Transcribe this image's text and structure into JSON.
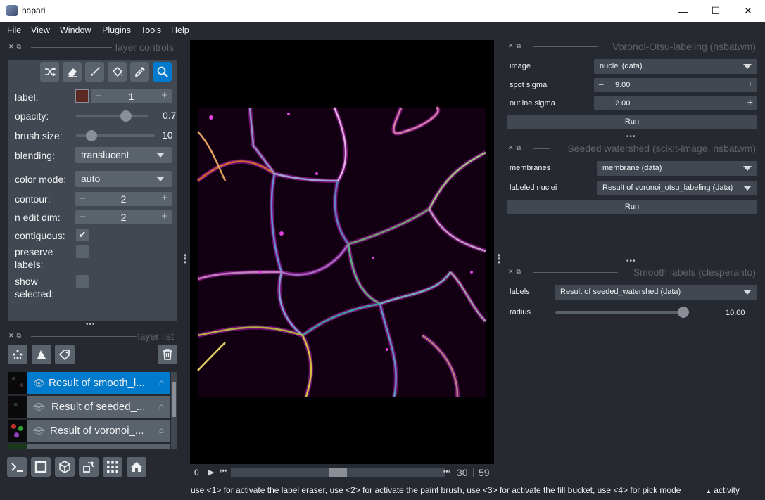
{
  "window": {
    "title": "napari",
    "minimize_glyph": "—",
    "maximize_glyph": "☐",
    "close_glyph": "✕"
  },
  "menu": [
    "File",
    "View",
    "Window",
    "Plugins",
    "Tools",
    "Help"
  ],
  "layer_controls": {
    "title": "layer controls",
    "tools": [
      "shuffle-icon",
      "eraser-icon",
      "paint-brush-icon",
      "fill-bucket-icon",
      "color-picker-icon",
      "zoom-icon"
    ],
    "label": {
      "text": "label:",
      "value": "1",
      "color": "#5a2a22"
    },
    "opacity": {
      "text": "opacity:",
      "value": "0.70",
      "fraction": 0.7
    },
    "brush_size": {
      "text": "brush size:",
      "value": "10",
      "fraction": 0.2
    },
    "blending": {
      "text": "blending:",
      "value": "translucent"
    },
    "color_mode": {
      "text": "color mode:",
      "value": "auto"
    },
    "contour": {
      "text": "contour:",
      "value": "2"
    },
    "n_edit_dim": {
      "text": "n edit dim:",
      "value": "2"
    },
    "contiguous": {
      "text": "contiguous:",
      "checked": true,
      "check_glyph": "✔"
    },
    "preserve_labels": {
      "text_line1": "preserve",
      "text_line2": "labels:",
      "checked": false
    },
    "show_selected": {
      "text_line1": "show",
      "text_line2": "selected:",
      "checked": false
    },
    "minus_glyph": "−",
    "plus_glyph": "+"
  },
  "layer_list": {
    "title": "layer list",
    "layers": [
      {
        "name": "Result of smooth_l...",
        "visible": true,
        "selected": true
      },
      {
        "name": "Result of seeded_...",
        "visible": false,
        "selected": false
      },
      {
        "name": "Result of voronoi_...",
        "visible": false,
        "selected": false
      }
    ],
    "eye_glyph": "👁",
    "tag_glyph": "⌂"
  },
  "dims": {
    "start": "0",
    "current": "30",
    "separator": "|",
    "total": "59",
    "position_fraction": 0.5
  },
  "status": {
    "message": "use <1> for activate the label eraser, use <2> for activate the paint brush, use <3> for activate the fill bucket, use <4> for pick mode",
    "activity": "activity",
    "activity_glyph": "▲"
  },
  "widgets": {
    "voronoi": {
      "title": "Voronoi-Otsu-labeling (nsbatwm)",
      "image_label": "image",
      "image_value": "nuclei (data)",
      "spot_sigma_label": "spot sigma",
      "spot_sigma_value": "9.00",
      "outline_sigma_label": "outline sigma",
      "outline_sigma_value": "2.00",
      "run": "Run"
    },
    "seeded": {
      "title": "Seeded watershed (scikit-image, nsbatwm)",
      "membranes_label": "membranes",
      "membranes_value": "membrane (data)",
      "nuclei_label": "labeled nuclei",
      "nuclei_value": "Result of voronoi_otsu_labeling (data)",
      "run": "Run"
    },
    "smooth": {
      "title": "Smooth labels (clesperanto)",
      "labels_label": "labels",
      "labels_value": "Result of seeded_watershed (data)",
      "radius_label": "radius",
      "radius_value": "10.00",
      "radius_fraction": 1.0
    },
    "dots": "•••"
  }
}
